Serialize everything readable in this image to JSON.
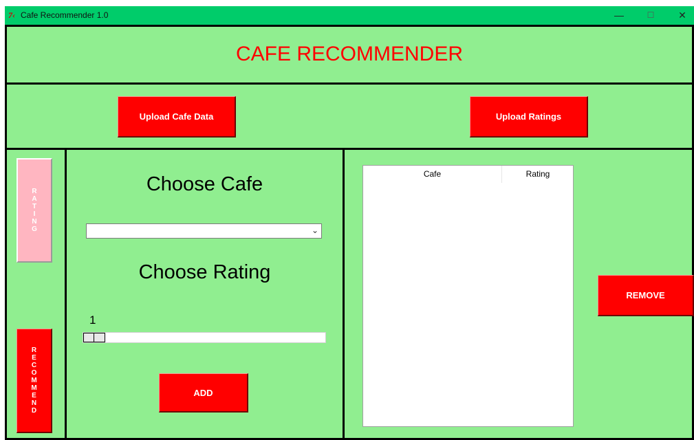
{
  "window": {
    "title": "Cafe Recommender 1.0",
    "icon": "tk-feather-icon",
    "minimize_glyph": "—",
    "maximize_glyph": "☐",
    "close_glyph": "✕"
  },
  "header": {
    "title": "CAFE RECOMMENDER"
  },
  "toolbar": {
    "upload_cafe_label": "Upload Cafe Data",
    "upload_ratings_label": "Upload Ratings"
  },
  "sidebar": {
    "rating_letters": [
      "R",
      "A",
      "T",
      "I",
      "N",
      "G"
    ],
    "recommend_letters": [
      "R",
      "E",
      "C",
      "O",
      "M",
      "M",
      "E",
      "N",
      "D"
    ]
  },
  "form": {
    "choose_cafe_label": "Choose Cafe",
    "cafe_value": "",
    "choose_rating_label": "Choose Rating",
    "rating_value": "1",
    "rating_fraction": 0,
    "add_label": "ADD"
  },
  "table": {
    "columns": [
      "Cafe",
      "Rating"
    ],
    "rows": []
  },
  "actions": {
    "remove_label": "REMOVE"
  },
  "colors": {
    "background": "#90ee90",
    "accent": "#ff0000",
    "disabled_button": "#ffb6c1",
    "titlebar": "#00cc6a"
  }
}
